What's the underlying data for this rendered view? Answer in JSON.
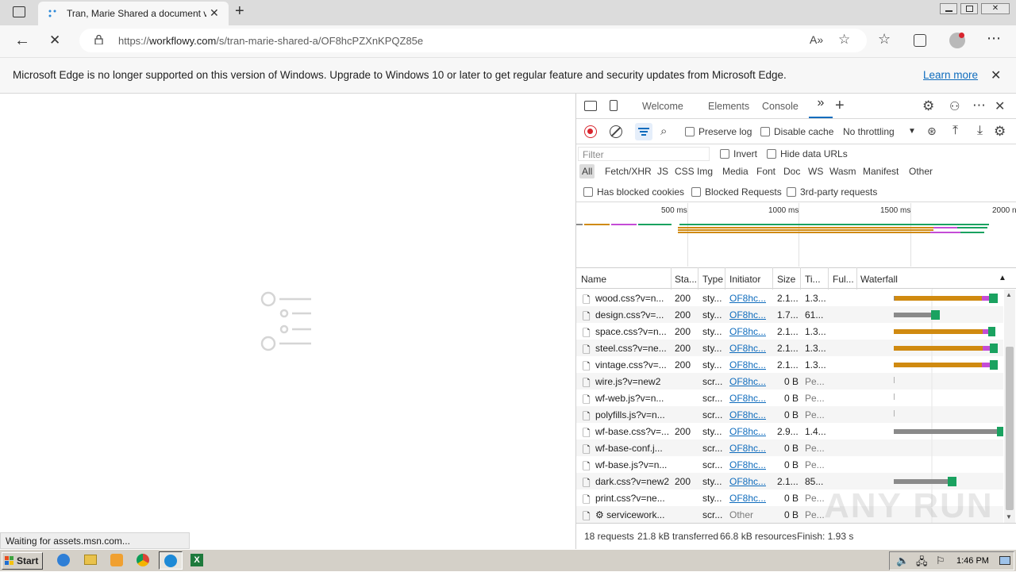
{
  "browser": {
    "tab_title": "Tran, Marie Shared a document v",
    "url_prefix": "https://",
    "url_domain": "workflowy.com",
    "url_path": "/s/tran-marie-shared-a/OF8hcPZXnKPQZ85e"
  },
  "infobar": {
    "message": "Microsoft Edge is no longer supported on this version of Windows. Upgrade to Windows 10 or later to get regular feature and security updates from Microsoft Edge.",
    "link": "Learn more"
  },
  "page": {
    "status_text": "Waiting for assets.msn.com..."
  },
  "devtools": {
    "tabs": [
      "Welcome",
      "Elements",
      "Console"
    ],
    "toolbar": {
      "preserve_log": "Preserve log",
      "disable_cache": "Disable cache",
      "throttling": "No throttling"
    },
    "filter": {
      "placeholder": "Filter",
      "invert": "Invert",
      "hide_data_urls": "Hide data URLs",
      "types": [
        "All",
        "Fetch/XHR",
        "JS",
        "CSS",
        "Img",
        "Media",
        "Font",
        "Doc",
        "WS",
        "Wasm",
        "Manifest",
        "Other"
      ],
      "has_blocked_cookies": "Has blocked cookies",
      "blocked_requests": "Blocked Requests",
      "third_party": "3rd-party requests"
    },
    "timeline_ticks": [
      "500 ms",
      "1000 ms",
      "1500 ms",
      "2000 n"
    ],
    "columns": [
      "Name",
      "Sta...",
      "Type",
      "Initiator",
      "Size",
      "Ti...",
      "Ful...",
      "Waterfall"
    ],
    "rows": [
      {
        "name": "wood.css?v=n...",
        "status": "200",
        "type": "sty...",
        "initiator": "OF8hc...",
        "size": "2.1...",
        "time": "1.3..."
      },
      {
        "name": "design.css?v=...",
        "status": "200",
        "type": "sty...",
        "initiator": "OF8hc...",
        "size": "1.7...",
        "time": "61..."
      },
      {
        "name": "space.css?v=n...",
        "status": "200",
        "type": "sty...",
        "initiator": "OF8hc...",
        "size": "2.1...",
        "time": "1.3..."
      },
      {
        "name": "steel.css?v=ne...",
        "status": "200",
        "type": "sty...",
        "initiator": "OF8hc...",
        "size": "2.1...",
        "time": "1.3..."
      },
      {
        "name": "vintage.css?v=...",
        "status": "200",
        "type": "sty...",
        "initiator": "OF8hc...",
        "size": "2.1...",
        "time": "1.3..."
      },
      {
        "name": "wire.js?v=new2",
        "status": "",
        "type": "scr...",
        "initiator": "OF8hc...",
        "size": "0 B",
        "time": "Pe..."
      },
      {
        "name": "wf-web.js?v=n...",
        "status": "",
        "type": "scr...",
        "initiator": "OF8hc...",
        "size": "0 B",
        "time": "Pe..."
      },
      {
        "name": "polyfills.js?v=n...",
        "status": "",
        "type": "scr...",
        "initiator": "OF8hc...",
        "size": "0 B",
        "time": "Pe..."
      },
      {
        "name": "wf-base.css?v=...",
        "status": "200",
        "type": "sty...",
        "initiator": "OF8hc...",
        "size": "2.9...",
        "time": "1.4..."
      },
      {
        "name": "wf-base-conf.j...",
        "status": "",
        "type": "scr...",
        "initiator": "OF8hc...",
        "size": "0 B",
        "time": "Pe..."
      },
      {
        "name": "wf-base.js?v=n...",
        "status": "",
        "type": "scr...",
        "initiator": "OF8hc...",
        "size": "0 B",
        "time": "Pe..."
      },
      {
        "name": "dark.css?v=new2",
        "status": "200",
        "type": "sty...",
        "initiator": "OF8hc...",
        "size": "2.1...",
        "time": "85..."
      },
      {
        "name": "print.css?v=ne...",
        "status": "",
        "type": "sty...",
        "initiator": "OF8hc...",
        "size": "0 B",
        "time": "Pe..."
      },
      {
        "name": "⚙ servicework...",
        "status": "",
        "type": "scr...",
        "initiator": "Other",
        "size": "0 B",
        "time": "Pe..."
      }
    ],
    "footer": {
      "requests": "18 requests",
      "transferred": "21.8 kB transferred",
      "resources": "66.8 kB resources",
      "finish": "Finish: 1.93 s"
    }
  },
  "taskbar": {
    "start": "Start",
    "clock": "1:46 PM"
  },
  "watermark": "ANY RUN",
  "colors": {
    "waiting": "#d08a10",
    "download": "#1aa260",
    "stalled": "#c44cd6",
    "queued": "#8a8a8a",
    "link": "#0f6cbd",
    "record": "#d8252e"
  }
}
